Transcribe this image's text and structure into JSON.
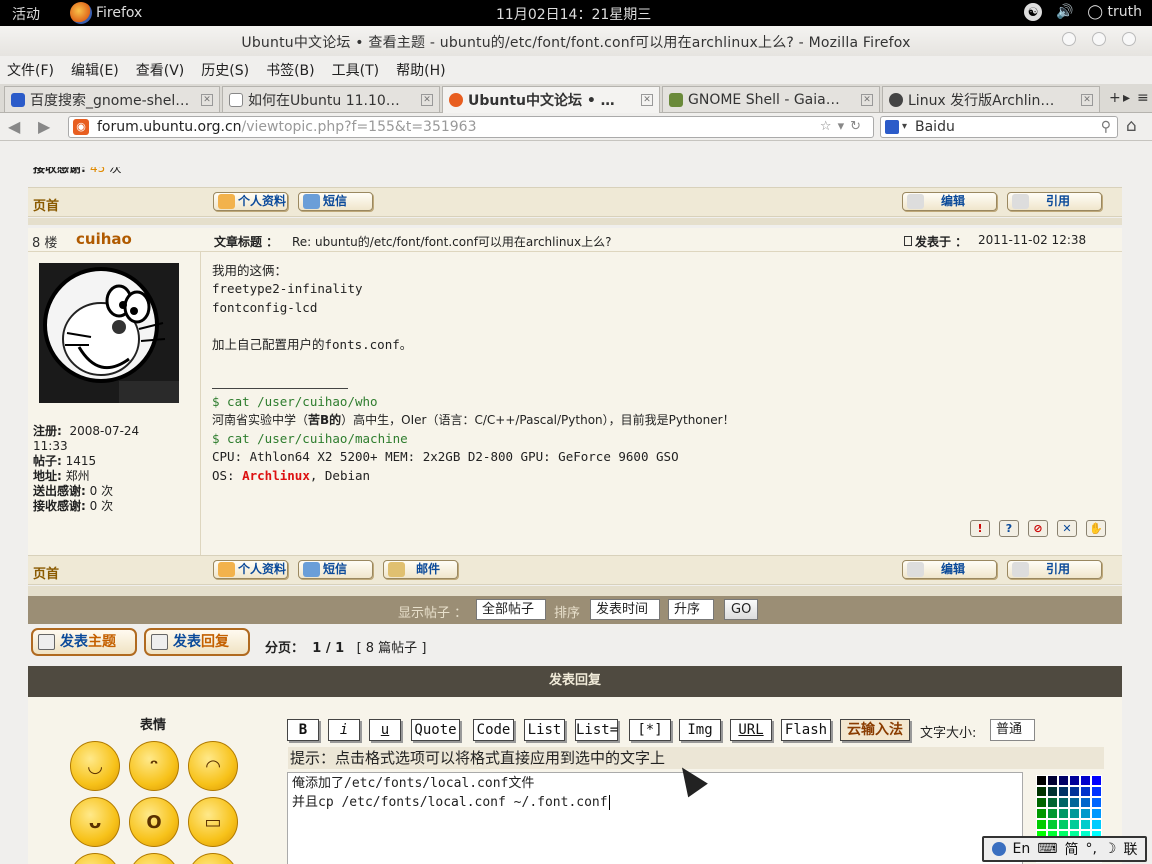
{
  "topbar": {
    "activities": "活动",
    "app_name": "Firefox",
    "clock": "11月02日14：21星期三",
    "user": "truth"
  },
  "window": {
    "title": "Ubuntu中文论坛 • 查看主题 - ubuntu的/etc/font/font.conf可以用在archlinux上么? - Mozilla Firefox"
  },
  "menu": [
    "文件(F)",
    "编辑(E)",
    "查看(V)",
    "历史(S)",
    "书签(B)",
    "工具(T)",
    "帮助(H)"
  ],
  "tabs": [
    {
      "label": "百度搜索_gnome-shel…",
      "active": false
    },
    {
      "label": "如何在Ubuntu 11.10…",
      "active": false
    },
    {
      "label": "Ubuntu中文论坛 • …",
      "active": true
    },
    {
      "label": "GNOME Shell - Gaia…",
      "active": false
    },
    {
      "label": "Linux 发行版Archlin…",
      "active": false
    }
  ],
  "nav": {
    "url_host": "forum.ubuntu.org.cn",
    "url_path": "/viewtopic.php?f=155&t=351963",
    "search_engine": "Baidu"
  },
  "prev_post": {
    "received_thanks_label": "接收感谢:",
    "received_thanks_count": "45",
    "received_thanks_unit": "次"
  },
  "post_toolbar": {
    "top_link": "页首",
    "profile": "个人资料",
    "pm": "短信",
    "email": "邮件",
    "edit": "编辑",
    "quote": "引用"
  },
  "post": {
    "floor": "8 楼",
    "author": "cuihao",
    "subject_label": "文章标题 ：",
    "subject": "Re: ubuntu的/etc/font/font.conf可以用在archlinux上么?",
    "posted_label": "发表于 ：",
    "posted": "2011-11-02 12:38",
    "user": {
      "registered_label": "注册:",
      "registered": "2008-07-24",
      "registered_time": "11:33",
      "posts_label": "帖子:",
      "posts": "1415",
      "location_label": "地址:",
      "location": "郑州",
      "sent_thanks_label": "送出感谢:",
      "sent_thanks": "0 次",
      "received_thanks_label": "接收感谢:",
      "received_thanks": "0 次"
    },
    "body": {
      "line1": "我用的这俩：",
      "line2": "freetype2-infinality",
      "line3": "fontconfig-lcd",
      "line4": "加上自己配置用户的fonts.conf。",
      "sig_cmd1": "$ cat /user/cuihao/who",
      "sig_who_pre": "河南省实验中学（",
      "sig_who_bold": "苦B的",
      "sig_who_post": "）高中生，OIer（语言：C/C++/Pascal/Python），目前我是Pythoner！",
      "sig_cmd2": "$ cat /user/cuihao/machine",
      "sig_machine": "CPU: Athlon64 X2 5200+ MEM: 2x2GB D2-800 GPU: GeForce 9600 GSO",
      "sig_os_label": "OS: ",
      "sig_os_arch": "Archlinux",
      "sig_os_rest": ", Debian"
    },
    "report_icons": [
      "report-icon",
      "info-icon",
      "warn-icon",
      "delete-icon",
      "thumbs-up-icon"
    ]
  },
  "sortbar": {
    "show_label": "显示帖子 ：",
    "show_value": "全部帖子",
    "sort_label": "排序",
    "sort_value": "发表时间",
    "order_value": "升序",
    "go": "GO"
  },
  "actions": {
    "new_topic_a": "发表",
    "new_topic_b": "主题",
    "reply_a": "发表",
    "reply_b": "回复",
    "pager_label": "分页：",
    "pager_value": "1 / 1",
    "post_count": "[ 8 篇帖子 ]"
  },
  "reply": {
    "header": "发表回复",
    "smilies_title": "表情",
    "format_buttons": [
      "B",
      "i",
      "u",
      "Quote",
      "Code",
      "List",
      "List=",
      "[*]",
      "Img",
      "URL",
      "Flash",
      "云输入法"
    ],
    "font_size_label": "文字大小:",
    "font_size_value": "普通",
    "hint": "提示：点击格式选项可以将格式直接应用到选中的文字上",
    "text_line1": "俺添加了/etc/fonts/local.conf文件",
    "text_line2": "并且cp /etc/fonts/local.conf ~/.font.conf"
  },
  "ime": {
    "lang": "En",
    "mode": "简",
    "punct": "°,",
    "moon": "☽",
    "link": "联"
  },
  "colors": {
    "accent_brown": "#b05a00",
    "link_blue": "#0b4a9a",
    "green_cmd": "#2e7d2e",
    "arch_red": "#d11",
    "sortbar_bg": "#9b8e75",
    "reply_header_bg": "#4f4a40"
  }
}
